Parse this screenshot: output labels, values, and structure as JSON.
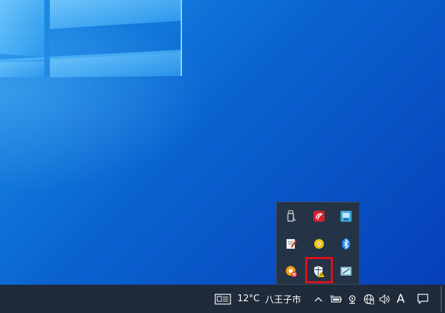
{
  "taskbar": {
    "weather_temp": "12°C",
    "weather_location": "八王子市",
    "ime_indicator": "A"
  },
  "tray_flyout": {
    "icons": [
      "usb-drive-icon",
      "red-app-icon",
      "network-monitor-icon",
      "notepad-icon",
      "disc-drive-icon",
      "bluetooth-icon",
      "orange-app-error-icon",
      "windows-security-warning-icon",
      "display-settings-icon"
    ]
  },
  "taskbar_icons": [
    "news-and-interests-icon",
    "chevron-up-icon",
    "battery-plugged-icon",
    "meeting-camera-icon",
    "network-globe-icon",
    "volume-icon",
    "notification-center-icon"
  ],
  "colors": {
    "desktop_accent": "#0a63d0",
    "taskbar": "#1f2a3a",
    "highlight": "#e0101a"
  }
}
